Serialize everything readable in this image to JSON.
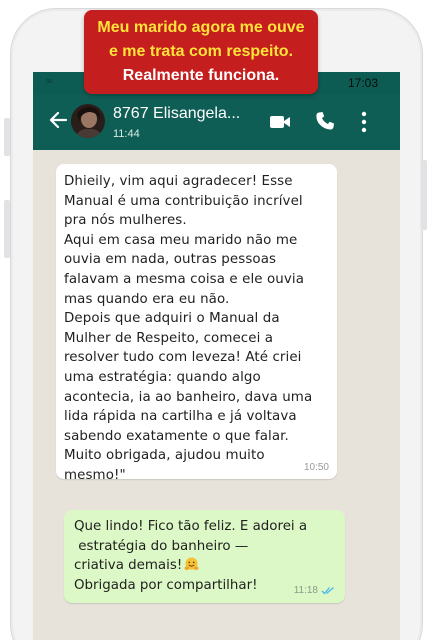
{
  "banner": {
    "line1": "Meu marido agora me ouve",
    "line2": "e me trata com respeito.",
    "line3": "Realmente funciona.",
    "line1_color": "#ffe33a",
    "line2_color": "#ffe33a",
    "line3_color": "#ffffff",
    "background": "#c51e1e"
  },
  "status_bar": {
    "time": "17:03",
    "left_icon": "infinity-icon"
  },
  "header": {
    "contact_name": "8767 Elisangela...",
    "contact_status": "11:44",
    "icons": [
      "back-arrow-icon",
      "avatar",
      "video-call-icon",
      "phone-call-icon",
      "more-options-icon"
    ],
    "color": "#0f5e55"
  },
  "messages": [
    {
      "direction": "incoming",
      "text": "Dhieily, vim aqui agradecer! Esse\nManual é uma contribuição incrível\npra nós mulheres.\nAqui em casa meu marido não me\nouvia em nada, outras pessoas\nfalavam a mesma coisa e ele ouvia\nmas quando era eu não.\nDepois que adquiri o Manual da\nMulher de Respeito, comecei a\nresolver tudo com leveza! Até criei\numa estratégia: quando algo\nacontecia, ia ao banheiro, dava uma\nlida rápida na cartilha e já voltava\nsabendo exatamente o que falar.\nMuito obrigada, ajudou muito\nmesmo!\"",
      "time": "10:50",
      "bubble_color": "#ffffff"
    },
    {
      "direction": "outgoing",
      "text_part1": "Que lindo! Fico tão feliz. E adorei a\n estratégia do banheiro —\ncriativa demais!",
      "emoji": "hugging-face-emoji",
      "text_part2": "\nObrigada por compartilhar!",
      "time": "11:18",
      "read_receipt": "double-check-icon",
      "bubble_color": "#dcf8c6"
    }
  ]
}
